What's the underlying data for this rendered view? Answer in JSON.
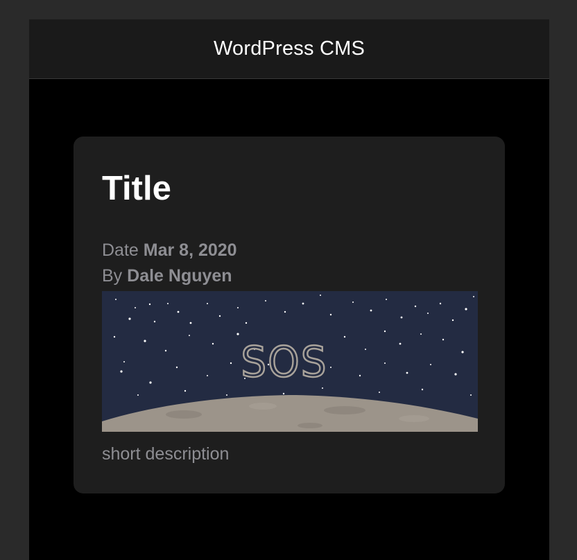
{
  "navbar": {
    "title": "WordPress CMS"
  },
  "post": {
    "title": "Title",
    "date_label": "Date",
    "date": "Mar 8, 2020",
    "author_label": "By",
    "author": "Dale Nguyen",
    "image_text": "SOS",
    "description": "short description"
  },
  "colors": {
    "background": "#000000",
    "card": "#1e1e1e",
    "muted_text": "#8e8e93",
    "sky": "#232b42",
    "moon": "#9c948a"
  }
}
